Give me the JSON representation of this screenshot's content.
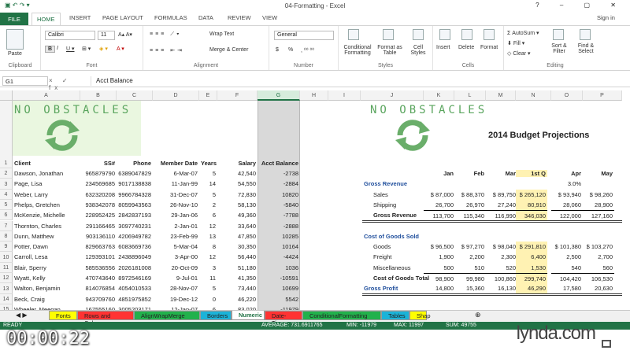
{
  "window": {
    "title": "04-Formatting - Excel",
    "controls": [
      "?",
      "–",
      "▢",
      "✕"
    ],
    "sign_in": "Sign in"
  },
  "ribbon_tabs": [
    "FILE",
    "HOME",
    "INSERT",
    "PAGE LAYOUT",
    "FORMULAS",
    "DATA",
    "REVIEW",
    "VIEW"
  ],
  "ribbon": {
    "clipboard": {
      "label": "Clipboard",
      "paste": "Paste"
    },
    "font": {
      "label": "Font",
      "font_name": "Calibri",
      "font_size": "11"
    },
    "alignment": {
      "label": "Alignment",
      "wrap": "Wrap Text",
      "merge": "Merge & Center"
    },
    "number": {
      "label": "Number",
      "format": "General",
      "currency": "$",
      "percent": "%"
    },
    "styles": {
      "label": "Styles",
      "cond": "Conditional Formatting",
      "table": "Format as Table",
      "cell": "Cell Styles"
    },
    "cells": {
      "label": "Cells",
      "insert": "Insert",
      "delete": "Delete",
      "format": "Format"
    },
    "editing": {
      "label": "Editing",
      "autosum": "AutoSum",
      "fill": "Fill",
      "clear": "Clear",
      "sort": "Sort & Filter",
      "find": "Find & Select"
    }
  },
  "formula_bar": {
    "name_box": "G1",
    "fx": "× ✓ fx",
    "content": "Acct Balance"
  },
  "columns": [
    "A",
    "B",
    "C",
    "D",
    "E",
    "F",
    "G",
    "H",
    "I",
    "J",
    "K",
    "L",
    "M",
    "N",
    "O",
    "P"
  ],
  "rows": [
    "1",
    "2",
    "3",
    "4",
    "5",
    "6",
    "7",
    "8",
    "9",
    "10",
    "11",
    "12",
    "13",
    "14",
    "15"
  ],
  "logo_text": "NO OBSTACLES",
  "headers": [
    "Client",
    "SS#",
    "Phone",
    "Member Date",
    "Years",
    "Salary",
    "Acct Balance"
  ],
  "clients": [
    [
      "Dawson, Jonathan",
      "965879790",
      "6389047829",
      "6-Mar-07",
      "5",
      "42,540",
      "-2738"
    ],
    [
      "Page, Lisa",
      "234569685",
      "9017138838",
      "11-Jan-99",
      "14",
      "54,550",
      "-2884"
    ],
    [
      "Weber, Larry",
      "632320208",
      "9966784328",
      "31-Dec-07",
      "5",
      "72,830",
      "10820"
    ],
    [
      "Phelps, Gretchen",
      "938342078",
      "8059943563",
      "26-Nov-10",
      "2",
      "58,130",
      "-5840"
    ],
    [
      "McKenzie, Michelle",
      "228952425",
      "2842837193",
      "29-Jan-06",
      "6",
      "49,360",
      "-7788"
    ],
    [
      "Thornton, Charles",
      "291166465",
      "3097740231",
      "2-Jan-01",
      "12",
      "33,640",
      "-2888"
    ],
    [
      "Dunn, Matthew",
      "903136110",
      "4206949782",
      "23-Feb-99",
      "13",
      "47,850",
      "10285"
    ],
    [
      "Potter, Dawn",
      "829663763",
      "6083669736",
      "5-Mar-04",
      "8",
      "30,350",
      "10164"
    ],
    [
      "Carroll, Lesa",
      "129393101",
      "2438896049",
      "3-Apr-00",
      "12",
      "56,440",
      "-4424"
    ],
    [
      "Blair, Sperry",
      "585536556",
      "2026181008",
      "20-Oct-09",
      "3",
      "51,180",
      "1036"
    ],
    [
      "Wyatt, Kelly",
      "470743640",
      "8972546169",
      "9-Jul-01",
      "11",
      "41,350",
      "-10591"
    ],
    [
      "Walton, Benjamin",
      "814076854",
      "4054010533",
      "28-Nov-07",
      "5",
      "73,440",
      "10699"
    ],
    [
      "Beck, Craig",
      "943709760",
      "4851975852",
      "19-Dec-12",
      "0",
      "46,220",
      "5542"
    ],
    [
      "Wheeler, Meegan",
      "167555160",
      "3005203171",
      "12-Jan-07",
      "6",
      "83,020",
      "-11979"
    ]
  ],
  "budget": {
    "title": "2014 Budget Projections",
    "months": [
      "Jan",
      "Feb",
      "Mar",
      "1st Q",
      "Apr",
      "May"
    ],
    "gross_revenue": "Gross Revenue",
    "pct": "3.0%",
    "rows": [
      {
        "label": "Sales",
        "vals": [
          "$ 87,000",
          "$ 88,370",
          "$ 89,750",
          "$ 265,120",
          "$ 93,940",
          "$ 98,260"
        ]
      },
      {
        "label": "Shipping",
        "vals": [
          "26,700",
          "26,970",
          "27,240",
          "80,910",
          "28,060",
          "28,900"
        ]
      },
      {
        "label": "Gross Revenue",
        "vals": [
          "113,700",
          "115,340",
          "116,990",
          "346,030",
          "122,000",
          "127,160"
        ]
      }
    ],
    "cogs": "Cost of Goods Sold",
    "cogs_rows": [
      {
        "label": "Goods",
        "vals": [
          "$ 96,500",
          "$ 97,270",
          "$ 98,040",
          "$ 291,810",
          "$ 101,380",
          "$ 103,270"
        ]
      },
      {
        "label": "Freight",
        "vals": [
          "1,900",
          "2,200",
          "2,300",
          "6,400",
          "2,500",
          "2,700"
        ]
      },
      {
        "label": "Miscellaneous",
        "vals": [
          "500",
          "510",
          "520",
          "1,530",
          "540",
          "560"
        ]
      },
      {
        "label": "Cost of Goods Total",
        "vals": [
          "98,900",
          "99,980",
          "100,860",
          "299,740",
          "104,420",
          "106,530"
        ]
      }
    ],
    "gross_profit": {
      "label": "Gross Profit",
      "vals": [
        "14,800",
        "15,360",
        "16,130",
        "46,290",
        "17,580",
        "20,630"
      ]
    }
  },
  "sheet_tabs": [
    {
      "name": "Fonts",
      "color": "#ffff00"
    },
    {
      "name": "Rows and Columns",
      "color": "#ff3333"
    },
    {
      "name": "AlignWrapMerge",
      "color": "#22b14c"
    },
    {
      "name": "Borders",
      "color": "#1bb3d8"
    },
    {
      "name": "Numeric",
      "color": "#ffffff"
    },
    {
      "name": "Date-Time",
      "color": "#ff3333"
    },
    {
      "name": "ConditionalFormatting",
      "color": "#22b14c"
    },
    {
      "name": "Tables",
      "color": "#1bb3d8"
    },
    {
      "name": "Shap",
      "color": "#ffff00"
    }
  ],
  "status": {
    "ready": "READY",
    "average": "AVERAGE: 731.6911765",
    "min": "MIN: -11979",
    "max": "MAX: 11997",
    "sum": "SUM: 49755"
  },
  "overlay": {
    "timecode": "00:00:22",
    "brand": "lynda.com"
  }
}
